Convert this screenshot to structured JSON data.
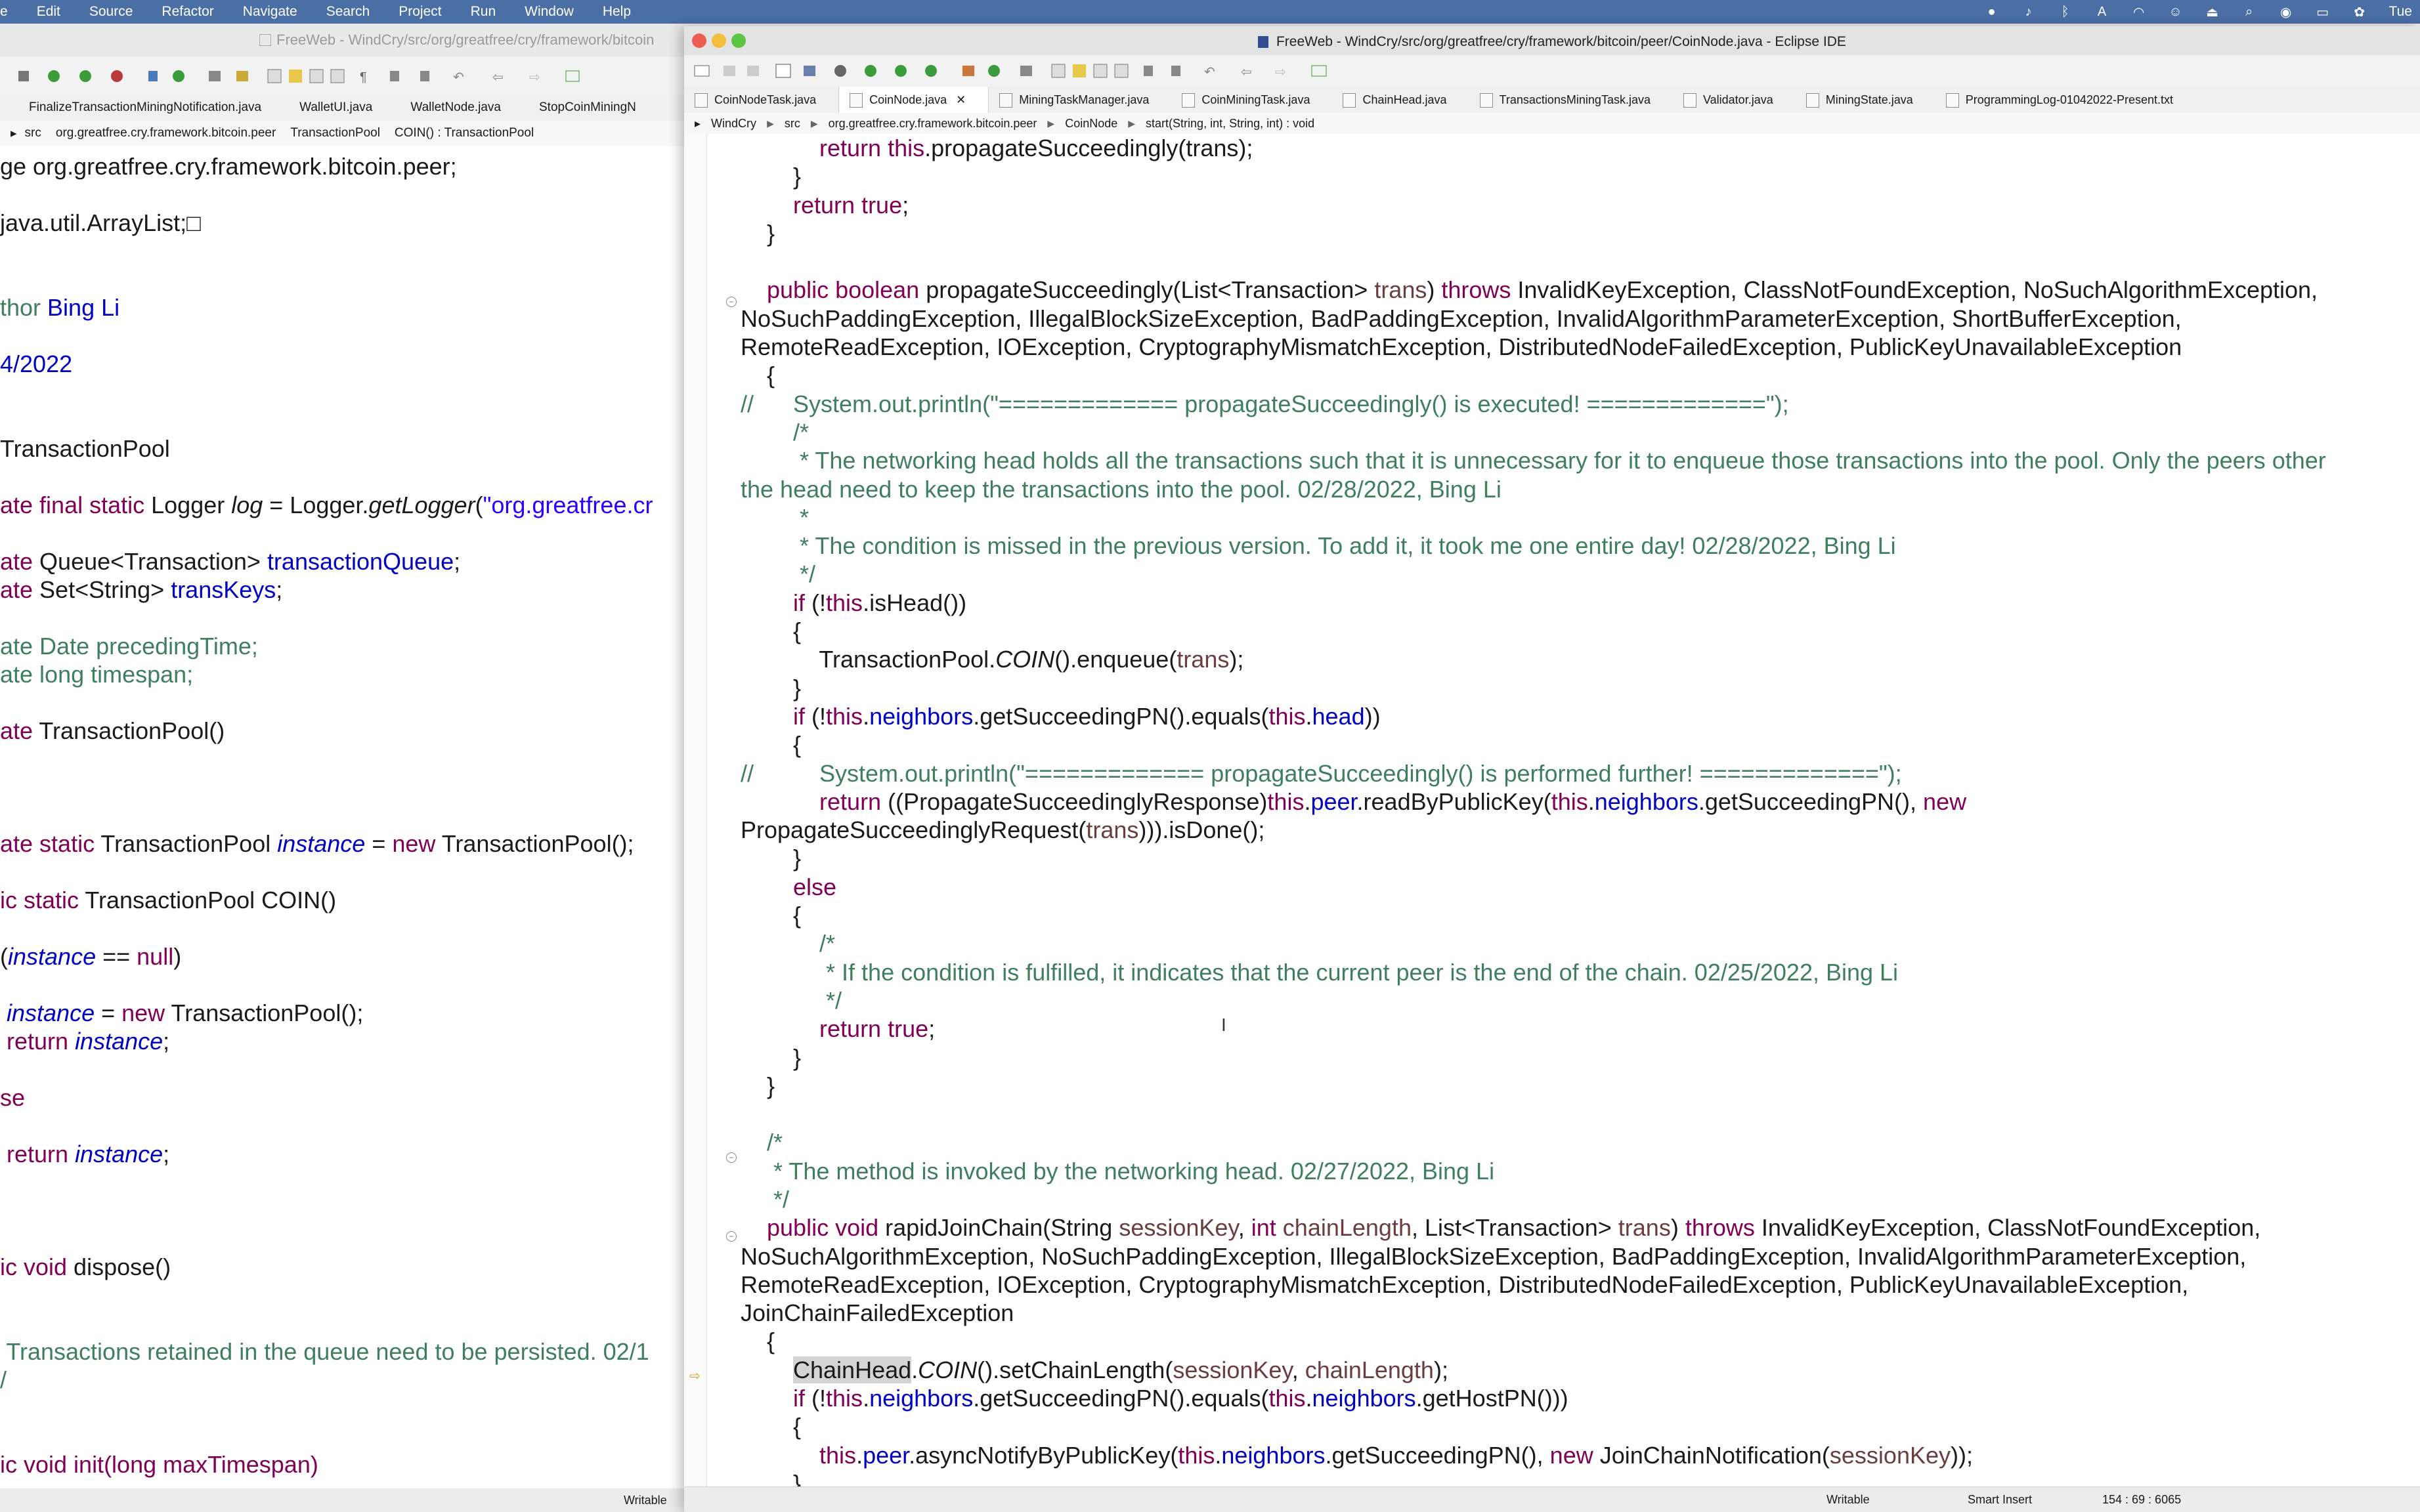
{
  "menubar": {
    "items": [
      "e",
      "Edit",
      "Source",
      "Refactor",
      "Navigate",
      "Search",
      "Project",
      "Run",
      "Window",
      "Help"
    ],
    "clock": "Tue"
  },
  "back_window": {
    "title": "FreeWeb - WindCry/src/org/greatfree/cry/framework/bitcoin",
    "tabs": [
      "FinalizeTransactionMiningNotification.java",
      "WalletUI.java",
      "WalletNode.java",
      "StopCoinMiningN"
    ],
    "breadcrumb": [
      "src",
      "org.greatfree.cry.framework.bitcoin.peer",
      "TransactionPool",
      "COIN() : TransactionPool"
    ],
    "status": "Writable",
    "code_lines": [
      [
        {
          "t": "ge org.greatfree.cry.framework.bitcoin.peer;"
        }
      ],
      [],
      [
        {
          "t": "java.util.ArrayList;"
        },
        {
          "t": "□"
        }
      ],
      [],
      [],
      [
        {
          "t": "thor ",
          "c": "cm"
        },
        {
          "t": "Bing Li",
          "c": "fld"
        }
      ],
      [],
      [
        {
          "t": "4/2022",
          "c": "fld"
        }
      ],
      [],
      [],
      [
        {
          "t": "TransactionPool"
        }
      ],
      [],
      [
        {
          "t": "ate final static ",
          "c": "kw"
        },
        {
          "t": "Logger "
        },
        {
          "t": "log",
          "c": "it"
        },
        {
          "t": " = Logger."
        },
        {
          "t": "getLogger",
          "c": "it"
        },
        {
          "t": "("
        },
        {
          "t": "\"org.greatfree.cr",
          "c": "st"
        }
      ],
      [],
      [
        {
          "t": "ate ",
          "c": "kw"
        },
        {
          "t": "Queue<Transaction> "
        },
        {
          "t": "transactionQueue",
          "c": "fld"
        },
        {
          "t": ";"
        }
      ],
      [
        {
          "t": "ate ",
          "c": "kw"
        },
        {
          "t": "Set<String> "
        },
        {
          "t": "transKeys",
          "c": "fld"
        },
        {
          "t": ";"
        }
      ],
      [],
      [
        {
          "t": "ate Date precedingTime;",
          "c": "cm"
        }
      ],
      [
        {
          "t": "ate long timespan;",
          "c": "cm"
        }
      ],
      [],
      [
        {
          "t": "ate ",
          "c": "kw"
        },
        {
          "t": "TransactionPool()"
        }
      ],
      [],
      [],
      [],
      [
        {
          "t": "ate static ",
          "c": "kw"
        },
        {
          "t": "TransactionPool "
        },
        {
          "t": "instance",
          "c": "fld it"
        },
        {
          "t": " = "
        },
        {
          "t": "new ",
          "c": "kw"
        },
        {
          "t": "TransactionPool();"
        }
      ],
      [],
      [
        {
          "t": "ic static ",
          "c": "kw"
        },
        {
          "t": "TransactionPool COIN()"
        }
      ],
      [],
      [
        {
          "t": "("
        },
        {
          "t": "instance",
          "c": "fld it"
        },
        {
          "t": " == "
        },
        {
          "t": "null",
          "c": "kw"
        },
        {
          "t": ")"
        }
      ],
      [],
      [
        {
          "t": " "
        },
        {
          "t": "instance",
          "c": "fld it"
        },
        {
          "t": " = "
        },
        {
          "t": "new ",
          "c": "kw"
        },
        {
          "t": "TransactionPool();"
        }
      ],
      [
        {
          "t": " "
        },
        {
          "t": "return ",
          "c": "kw"
        },
        {
          "t": "instance",
          "c": "fld it"
        },
        {
          "t": ";"
        }
      ],
      [],
      [
        {
          "t": "se",
          "c": "kw"
        }
      ],
      [],
      [
        {
          "t": " "
        },
        {
          "t": "return ",
          "c": "kw"
        },
        {
          "t": "instance",
          "c": "fld it"
        },
        {
          "t": ";"
        }
      ],
      [],
      [],
      [],
      [
        {
          "t": "ic void ",
          "c": "kw"
        },
        {
          "t": "dispose()"
        }
      ],
      [],
      [],
      [
        {
          "t": " Transactions retained in the queue need to be persisted. 02/1",
          "c": "cm"
        }
      ],
      [
        {
          "t": "/",
          "c": "cm"
        }
      ],
      [],
      [],
      [
        {
          "t": "ic void init(long maxTimespan)",
          "c": "kw"
        }
      ]
    ]
  },
  "front_window": {
    "title": "FreeWeb - WindCry/src/org/greatfree/cry/framework/bitcoin/peer/CoinNode.java - Eclipse IDE",
    "tabs": [
      {
        "label": "CoinNodeTask.java",
        "active": false
      },
      {
        "label": "CoinNode.java",
        "active": true
      },
      {
        "label": "MiningTaskManager.java",
        "active": false
      },
      {
        "label": "CoinMiningTask.java",
        "active": false
      },
      {
        "label": "ChainHead.java",
        "active": false
      },
      {
        "label": "TransactionsMiningTask.java",
        "active": false
      },
      {
        "label": "Validator.java",
        "active": false
      },
      {
        "label": "MiningState.java",
        "active": false
      },
      {
        "label": "ProgrammingLog-01042022-Present.txt",
        "active": false
      }
    ],
    "breadcrumb": [
      "WindCry",
      "src",
      "org.greatfree.cry.framework.bitcoin.peer",
      "CoinNode",
      "start(String, int, String, int) : void"
    ],
    "status": {
      "writable": "Writable",
      "insert_mode": "Smart Insert",
      "position": "154 : 69 : 6065"
    },
    "code_lines": [
      [
        {
          "t": "            "
        },
        {
          "t": "return this",
          "c": "kw"
        },
        {
          "t": ".propagateSucceedingly(trans);"
        }
      ],
      [
        {
          "t": "        }"
        }
      ],
      [
        {
          "t": "        "
        },
        {
          "t": "return true",
          "c": "kw"
        },
        {
          "t": ";"
        }
      ],
      [
        {
          "t": "    }"
        }
      ],
      [],
      [
        {
          "t": "    "
        },
        {
          "t": "public boolean ",
          "c": "kw"
        },
        {
          "t": "propagateSucceedingly(List<Transaction> "
        },
        {
          "t": "trans",
          "c": "par"
        },
        {
          "t": ") "
        },
        {
          "t": "throws ",
          "c": "kw"
        },
        {
          "t": "InvalidKeyException, ClassNotFoundException, NoSuchAlgorithmException,"
        }
      ],
      [
        {
          "t": "NoSuchPaddingException, IllegalBlockSizeException, BadPaddingException, InvalidAlgorithmParameterException, ShortBufferException,"
        }
      ],
      [
        {
          "t": "RemoteReadException, IOException, CryptographyMismatchException, DistributedNodeFailedException, PublicKeyUnavailableException"
        }
      ],
      [
        {
          "t": "    {"
        }
      ],
      [
        {
          "t": "//      System.out.println(\"============= propagateSucceedingly() is executed! =============\");",
          "c": "cm"
        }
      ],
      [
        {
          "t": "        /*",
          "c": "cm"
        }
      ],
      [
        {
          "t": "         * The networking head holds all the transactions such that it is unnecessary for it to enqueue those transactions into the pool. Only the peers other",
          "c": "cm"
        }
      ],
      [
        {
          "t": "the head need to keep the transactions into the pool. 02/28/2022, Bing Li",
          "c": "cm"
        }
      ],
      [
        {
          "t": "         *",
          "c": "cm"
        }
      ],
      [
        {
          "t": "         * The condition is missed in the previous version. To add it, it took me one entire day! 02/28/2022, Bing Li",
          "c": "cm"
        }
      ],
      [
        {
          "t": "         */",
          "c": "cm"
        }
      ],
      [
        {
          "t": "        "
        },
        {
          "t": "if ",
          "c": "kw"
        },
        {
          "t": "(!"
        },
        {
          "t": "this",
          "c": "kw"
        },
        {
          "t": ".isHead())"
        }
      ],
      [
        {
          "t": "        {"
        }
      ],
      [
        {
          "t": "            TransactionPool."
        },
        {
          "t": "COIN",
          "c": "it"
        },
        {
          "t": "().enqueue("
        },
        {
          "t": "trans",
          "c": "par"
        },
        {
          "t": ");"
        }
      ],
      [
        {
          "t": "        }"
        }
      ],
      [
        {
          "t": "        "
        },
        {
          "t": "if ",
          "c": "kw"
        },
        {
          "t": "(!"
        },
        {
          "t": "this",
          "c": "kw"
        },
        {
          "t": "."
        },
        {
          "t": "neighbors",
          "c": "fld"
        },
        {
          "t": ".getSucceedingPN().equals("
        },
        {
          "t": "this",
          "c": "kw"
        },
        {
          "t": "."
        },
        {
          "t": "head",
          "c": "fld"
        },
        {
          "t": "))"
        }
      ],
      [
        {
          "t": "        {"
        }
      ],
      [
        {
          "t": "//          System.out.println(\"============= propagateSucceedingly() is performed further! =============\");",
          "c": "cm"
        }
      ],
      [
        {
          "t": "            "
        },
        {
          "t": "return ",
          "c": "kw"
        },
        {
          "t": "((PropagateSucceedinglyResponse)"
        },
        {
          "t": "this",
          "c": "kw"
        },
        {
          "t": "."
        },
        {
          "t": "peer",
          "c": "fld"
        },
        {
          "t": ".readByPublicKey("
        },
        {
          "t": "this",
          "c": "kw"
        },
        {
          "t": "."
        },
        {
          "t": "neighbors",
          "c": "fld"
        },
        {
          "t": ".getSucceedingPN(), "
        },
        {
          "t": "new",
          "c": "kw"
        }
      ],
      [
        {
          "t": "PropagateSucceedinglyRequest("
        },
        {
          "t": "trans",
          "c": "par"
        },
        {
          "t": "))).isDone();"
        }
      ],
      [
        {
          "t": "        }"
        }
      ],
      [
        {
          "t": "        "
        },
        {
          "t": "else",
          "c": "kw"
        }
      ],
      [
        {
          "t": "        {"
        }
      ],
      [
        {
          "t": "            /*",
          "c": "cm"
        }
      ],
      [
        {
          "t": "             * If the condition is fulfilled, it indicates that the current peer is the end of the chain. 02/25/2022, Bing Li",
          "c": "cm"
        }
      ],
      [
        {
          "t": "             */",
          "c": "cm"
        }
      ],
      [
        {
          "t": "            "
        },
        {
          "t": "return true",
          "c": "kw"
        },
        {
          "t": ";"
        }
      ],
      [
        {
          "t": "        }"
        }
      ],
      [
        {
          "t": "    }"
        }
      ],
      [],
      [
        {
          "t": "    /*",
          "c": "cm"
        }
      ],
      [
        {
          "t": "     * The method is invoked by the networking head. 02/27/2022, Bing Li",
          "c": "cm"
        }
      ],
      [
        {
          "t": "     */",
          "c": "cm"
        }
      ],
      [
        {
          "t": "    "
        },
        {
          "t": "public void ",
          "c": "kw"
        },
        {
          "t": "rapidJoinChain(String "
        },
        {
          "t": "sessionKey",
          "c": "par"
        },
        {
          "t": ", "
        },
        {
          "t": "int ",
          "c": "kw"
        },
        {
          "t": "chainLength",
          "c": "par"
        },
        {
          "t": ", List<Transaction> "
        },
        {
          "t": "trans",
          "c": "par"
        },
        {
          "t": ") "
        },
        {
          "t": "throws ",
          "c": "kw"
        },
        {
          "t": "InvalidKeyException, ClassNotFoundException,"
        }
      ],
      [
        {
          "t": "NoSuchAlgorithmException, NoSuchPaddingException, IllegalBlockSizeException, BadPaddingException, InvalidAlgorithmParameterException,"
        }
      ],
      [
        {
          "t": "RemoteReadException, IOException, CryptographyMismatchException, DistributedNodeFailedException, PublicKeyUnavailableException,"
        }
      ],
      [
        {
          "t": "JoinChainFailedException"
        }
      ],
      [
        {
          "t": "    {"
        }
      ],
      [
        {
          "t": "        "
        },
        {
          "t": "ChainHead",
          "c": "hl"
        },
        {
          "t": "."
        },
        {
          "t": "COIN",
          "c": "it"
        },
        {
          "t": "().setChainLength("
        },
        {
          "t": "sessionKey",
          "c": "par"
        },
        {
          "t": ", "
        },
        {
          "t": "chainLength",
          "c": "par"
        },
        {
          "t": ");"
        }
      ],
      [
        {
          "t": "        "
        },
        {
          "t": "if ",
          "c": "kw"
        },
        {
          "t": "(!"
        },
        {
          "t": "this",
          "c": "kw"
        },
        {
          "t": "."
        },
        {
          "t": "neighbors",
          "c": "fld"
        },
        {
          "t": ".getSucceedingPN().equals("
        },
        {
          "t": "this",
          "c": "kw"
        },
        {
          "t": "."
        },
        {
          "t": "neighbors",
          "c": "fld"
        },
        {
          "t": ".getHostPN()))"
        }
      ],
      [
        {
          "t": "        {"
        }
      ],
      [
        {
          "t": "            "
        },
        {
          "t": "this",
          "c": "kw"
        },
        {
          "t": "."
        },
        {
          "t": "peer",
          "c": "fld"
        },
        {
          "t": ".asyncNotifyByPublicKey("
        },
        {
          "t": "this",
          "c": "kw"
        },
        {
          "t": "."
        },
        {
          "t": "neighbors",
          "c": "fld"
        },
        {
          "t": ".getSucceedingPN(), "
        },
        {
          "t": "new ",
          "c": "kw"
        },
        {
          "t": "JoinChainNotification("
        },
        {
          "t": "sessionKey",
          "c": "par"
        },
        {
          "t": "));"
        }
      ],
      [
        {
          "t": "        }"
        }
      ]
    ]
  },
  "colors": {
    "keyword": "#7f0055",
    "field": "#0000c0",
    "comment": "#3f7f5f",
    "string": "#2a00ff",
    "param": "#6a3e3e"
  }
}
